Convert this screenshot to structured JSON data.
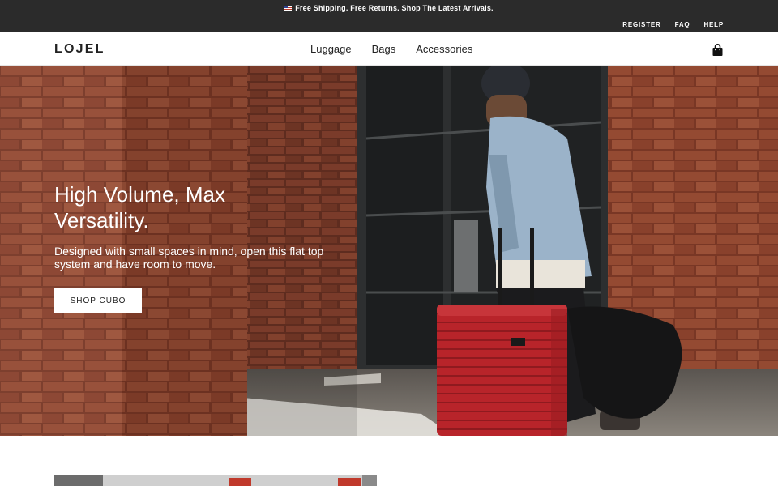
{
  "announcement": {
    "flag_icon": "us-flag-icon",
    "message": "Free Shipping. Free Returns. Shop The Latest Arrivals."
  },
  "utility_links": [
    {
      "label": "REGISTER"
    },
    {
      "label": "FAQ"
    },
    {
      "label": "HELP"
    }
  ],
  "header": {
    "logo": "LOJEL",
    "nav": [
      {
        "label": "Luggage"
      },
      {
        "label": "Bags"
      },
      {
        "label": "Accessories"
      }
    ],
    "cart_icon": "shopping-bag-icon"
  },
  "hero": {
    "title": "High Volume, Max Versatility.",
    "subtitle": "Designed with small spaces in mind, open this flat top system and have room to move.",
    "cta": "SHOP CUBO"
  },
  "colors": {
    "announcement_bg": "#2b2b2b",
    "suitcase_red": "#b3262a",
    "brick": "#9a4a33"
  }
}
